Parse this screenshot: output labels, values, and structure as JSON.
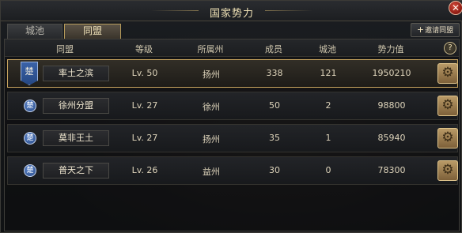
{
  "window": {
    "title": "国家势力",
    "close_symbol": "✕"
  },
  "tabs": [
    {
      "label": "城池",
      "active": false
    },
    {
      "label": "同盟",
      "active": true
    }
  ],
  "invite_button": {
    "plus": "+",
    "label": "邀请同盟"
  },
  "table": {
    "headers": {
      "alliance": "同盟",
      "level": "等级",
      "state": "所属州",
      "members": "成员",
      "cities": "城池",
      "power": "势力值",
      "help": "?"
    },
    "rows": [
      {
        "emblem": "楚",
        "emblem_style": "banner",
        "name": "率土之滨",
        "level": "Lv. 50",
        "state": "扬州",
        "members": "338",
        "cities": "121",
        "power": "1950210",
        "selected": true
      },
      {
        "emblem": "楚",
        "emblem_style": "round",
        "name": "徐州分盟",
        "level": "Lv. 27",
        "state": "徐州",
        "members": "50",
        "cities": "2",
        "power": "98800",
        "selected": false
      },
      {
        "emblem": "楚",
        "emblem_style": "round",
        "name": "莫非王土",
        "level": "Lv. 27",
        "state": "扬州",
        "members": "35",
        "cities": "1",
        "power": "85940",
        "selected": false
      },
      {
        "emblem": "楚",
        "emblem_style": "round",
        "name": "普天之下",
        "level": "Lv. 26",
        "state": "益州",
        "members": "30",
        "cities": "0",
        "power": "78300",
        "selected": false
      }
    ],
    "row_action_icon": "gear-icon"
  },
  "colors": {
    "accent_gold": "#c9a55f",
    "emblem_blue": "#2a4b86",
    "close_red": "#b02c20"
  }
}
